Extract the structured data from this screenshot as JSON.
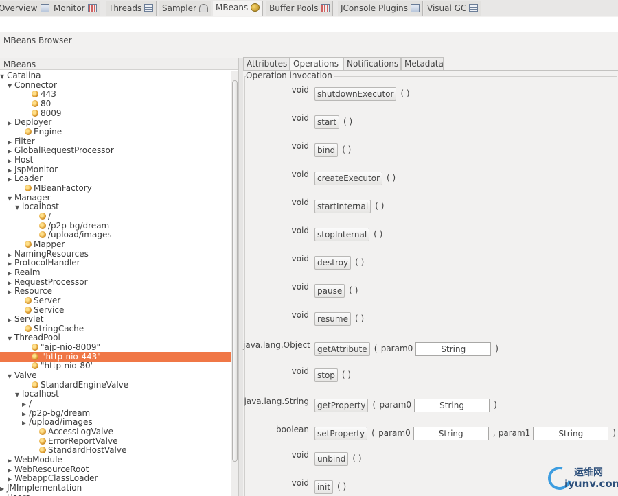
{
  "tabs": [
    {
      "label": "Overview",
      "icon": "overview-icon"
    },
    {
      "label": "Monitor",
      "icon": "chart-icon"
    },
    {
      "label": "Threads",
      "icon": "list-icon"
    },
    {
      "label": "Sampler",
      "icon": "person-icon"
    },
    {
      "label": "MBeans",
      "icon": "beans-icon",
      "active": true
    },
    {
      "label": "Buffer Pools",
      "icon": "chart-icon"
    },
    {
      "label": "JConsole Plugins",
      "icon": "window-icon"
    },
    {
      "label": "Visual GC",
      "icon": "list-icon"
    }
  ],
  "browser_title": "MBeans Browser",
  "left_header": "MBeans",
  "tree": [
    {
      "label": "Catalina",
      "level": 0,
      "type": "folder",
      "expanded": true
    },
    {
      "label": "Connector",
      "level": 1,
      "type": "folder",
      "expanded": true
    },
    {
      "label": "443",
      "level": 3,
      "type": "bean"
    },
    {
      "label": "80",
      "level": 3,
      "type": "bean"
    },
    {
      "label": "8009",
      "level": 3,
      "type": "bean"
    },
    {
      "label": "Deployer",
      "level": 1,
      "type": "folder",
      "expanded": false
    },
    {
      "label": "Engine",
      "level": 2,
      "type": "bean"
    },
    {
      "label": "Filter",
      "level": 1,
      "type": "folder",
      "expanded": false
    },
    {
      "label": "GlobalRequestProcessor",
      "level": 1,
      "type": "folder",
      "expanded": false
    },
    {
      "label": "Host",
      "level": 1,
      "type": "folder",
      "expanded": false
    },
    {
      "label": "JspMonitor",
      "level": 1,
      "type": "folder",
      "expanded": false
    },
    {
      "label": "Loader",
      "level": 1,
      "type": "folder",
      "expanded": false
    },
    {
      "label": "MBeanFactory",
      "level": 2,
      "type": "bean"
    },
    {
      "label": "Manager",
      "level": 1,
      "type": "folder",
      "expanded": true
    },
    {
      "label": "localhost",
      "level": 2,
      "type": "folder",
      "expanded": true
    },
    {
      "label": "/",
      "level": 4,
      "type": "bean"
    },
    {
      "label": "/p2p-bg/dream",
      "level": 4,
      "type": "bean"
    },
    {
      "label": "/upload/images",
      "level": 4,
      "type": "bean"
    },
    {
      "label": "Mapper",
      "level": 2,
      "type": "bean"
    },
    {
      "label": "NamingResources",
      "level": 1,
      "type": "folder",
      "expanded": false
    },
    {
      "label": "ProtocolHandler",
      "level": 1,
      "type": "folder",
      "expanded": false
    },
    {
      "label": "Realm",
      "level": 1,
      "type": "folder",
      "expanded": false
    },
    {
      "label": "RequestProcessor",
      "level": 1,
      "type": "folder",
      "expanded": false
    },
    {
      "label": "Resource",
      "level": 1,
      "type": "folder",
      "expanded": false
    },
    {
      "label": "Server",
      "level": 2,
      "type": "bean"
    },
    {
      "label": "Service",
      "level": 2,
      "type": "bean"
    },
    {
      "label": "Servlet",
      "level": 1,
      "type": "folder",
      "expanded": false
    },
    {
      "label": "StringCache",
      "level": 2,
      "type": "bean"
    },
    {
      "label": "ThreadPool",
      "level": 1,
      "type": "folder",
      "expanded": true
    },
    {
      "label": "\"ajp-nio-8009\"",
      "level": 3,
      "type": "bean"
    },
    {
      "label": "\"http-nio-443\"",
      "level": 3,
      "type": "bean",
      "selected": true
    },
    {
      "label": "\"http-nio-80\"",
      "level": 3,
      "type": "bean"
    },
    {
      "label": "Valve",
      "level": 1,
      "type": "folder",
      "expanded": true
    },
    {
      "label": "StandardEngineValve",
      "level": 3,
      "type": "bean"
    },
    {
      "label": "localhost",
      "level": 2,
      "type": "folder",
      "expanded": true
    },
    {
      "label": "/",
      "level": 3,
      "type": "folder",
      "expanded": false
    },
    {
      "label": "/p2p-bg/dream",
      "level": 3,
      "type": "folder",
      "expanded": false
    },
    {
      "label": "/upload/images",
      "level": 3,
      "type": "folder",
      "expanded": false
    },
    {
      "label": "AccessLogValve",
      "level": 4,
      "type": "bean"
    },
    {
      "label": "ErrorReportValve",
      "level": 4,
      "type": "bean"
    },
    {
      "label": "StandardHostValve",
      "level": 4,
      "type": "bean"
    },
    {
      "label": "WebModule",
      "level": 1,
      "type": "folder",
      "expanded": false
    },
    {
      "label": "WebResourceRoot",
      "level": 1,
      "type": "folder",
      "expanded": false
    },
    {
      "label": "WebappClassLoader",
      "level": 1,
      "type": "folder",
      "expanded": false
    },
    {
      "label": "JMImplementation",
      "level": 0,
      "type": "folder",
      "expanded": false
    },
    {
      "label": "Users",
      "level": 0,
      "type": "folder",
      "expanded": false
    }
  ],
  "right_tabs": [
    {
      "label": "Attributes"
    },
    {
      "label": "Operations",
      "active": true
    },
    {
      "label": "Notifications"
    },
    {
      "label": "Metadata"
    }
  ],
  "operation_group_title": "Operation invocation",
  "operations": [
    {
      "return": "void",
      "name": "shutdownExecutor",
      "params": []
    },
    {
      "return": "void",
      "name": "start",
      "params": []
    },
    {
      "return": "void",
      "name": "bind",
      "params": []
    },
    {
      "return": "void",
      "name": "createExecutor",
      "params": []
    },
    {
      "return": "void",
      "name": "startInternal",
      "params": []
    },
    {
      "return": "void",
      "name": "stopInternal",
      "params": []
    },
    {
      "return": "void",
      "name": "destroy",
      "params": []
    },
    {
      "return": "void",
      "name": "pause",
      "params": []
    },
    {
      "return": "void",
      "name": "resume",
      "params": []
    },
    {
      "return": "java.lang.Object",
      "name": "getAttribute",
      "params": [
        {
          "name": "param0",
          "value": "String"
        }
      ]
    },
    {
      "return": "void",
      "name": "stop",
      "params": []
    },
    {
      "return": "java.lang.String",
      "name": "getProperty",
      "params": [
        {
          "name": "param0",
          "value": "String"
        }
      ]
    },
    {
      "return": "boolean",
      "name": "setProperty",
      "params": [
        {
          "name": "param0",
          "value": "String"
        },
        {
          "name": "param1",
          "value": "String"
        }
      ]
    },
    {
      "return": "void",
      "name": "unbind",
      "params": []
    },
    {
      "return": "void",
      "name": "init",
      "params": []
    }
  ],
  "watermark": {
    "cn": "运维网",
    "en": "iyunv.com"
  }
}
